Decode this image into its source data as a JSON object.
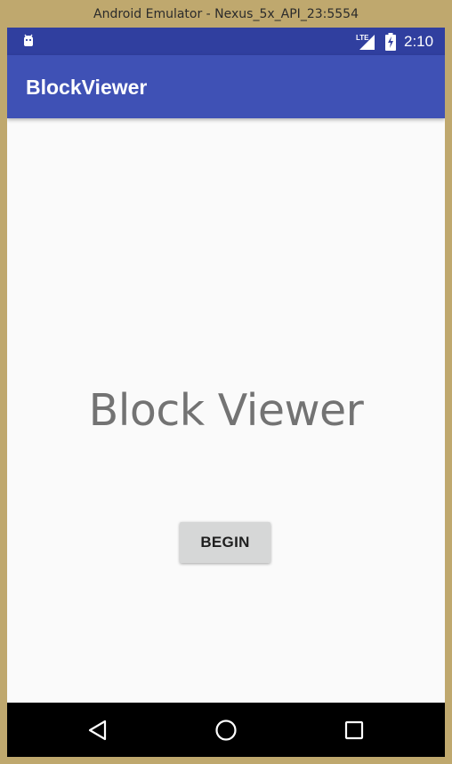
{
  "window": {
    "title": "Android Emulator - Nexus_5x_API_23:5554"
  },
  "status_bar": {
    "left_icon": "android-debug-icon",
    "network_label": "LTE",
    "network_icon": "signal-icon",
    "battery_icon": "battery-charging-icon",
    "time": "2:10"
  },
  "app_bar": {
    "title": "BlockViewer",
    "color": "#3f51b5",
    "status_color": "#303f9f"
  },
  "main": {
    "headline": "Block Viewer",
    "begin_label": "BEGIN"
  },
  "nav_bar": {
    "back_icon": "back-triangle-icon",
    "home_icon": "home-circle-icon",
    "recents_icon": "recents-square-icon"
  }
}
